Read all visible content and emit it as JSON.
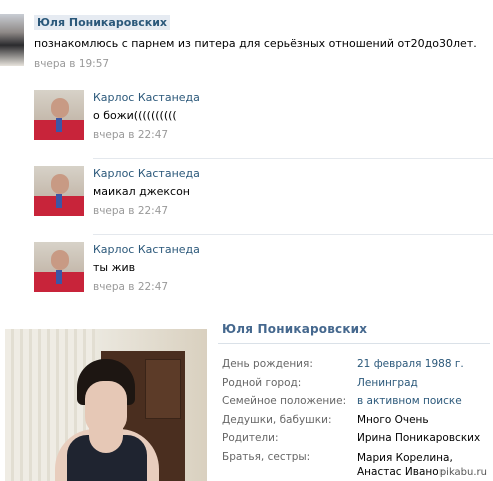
{
  "post": {
    "author": "Юля Поникаровских",
    "text": "познакомлюсь с парнем из питера для серьёзных отношений от20до30лет.",
    "time": "вчера в 19:57"
  },
  "comments": [
    {
      "author": "Карлос Кастанеда",
      "text": "о божи((((((((((",
      "time": "вчера в 22:47"
    },
    {
      "author": "Карлос Кастанеда",
      "text": "маикал джексон",
      "time": "вчера в 22:47"
    },
    {
      "author": "Карлос Кастанеда",
      "text": "ты жив",
      "time": "вчера в 22:47"
    }
  ],
  "profile": {
    "name": "Юля Поникаровских",
    "info": [
      {
        "label": "День рождения:",
        "value": "21 февраля 1988 г.",
        "link": true
      },
      {
        "label": "Родной город:",
        "value": "Ленинград",
        "link": true
      },
      {
        "label": "Семейное положение:",
        "value": "в активном поиске",
        "link": true
      },
      {
        "label": "Дедушки, бабушки:",
        "value": "Много Очень",
        "link": false
      },
      {
        "label": "Родители:",
        "value": "Ирина Поникаровских",
        "link": false
      },
      {
        "label": "Братья, сестры:",
        "value": "Мария Корелина, Анастас Иванов",
        "link": false
      }
    ]
  },
  "watermark": "pikabu.ru",
  "colors": {
    "link": "#2b587a",
    "muted": "#999999",
    "label": "#666666"
  }
}
